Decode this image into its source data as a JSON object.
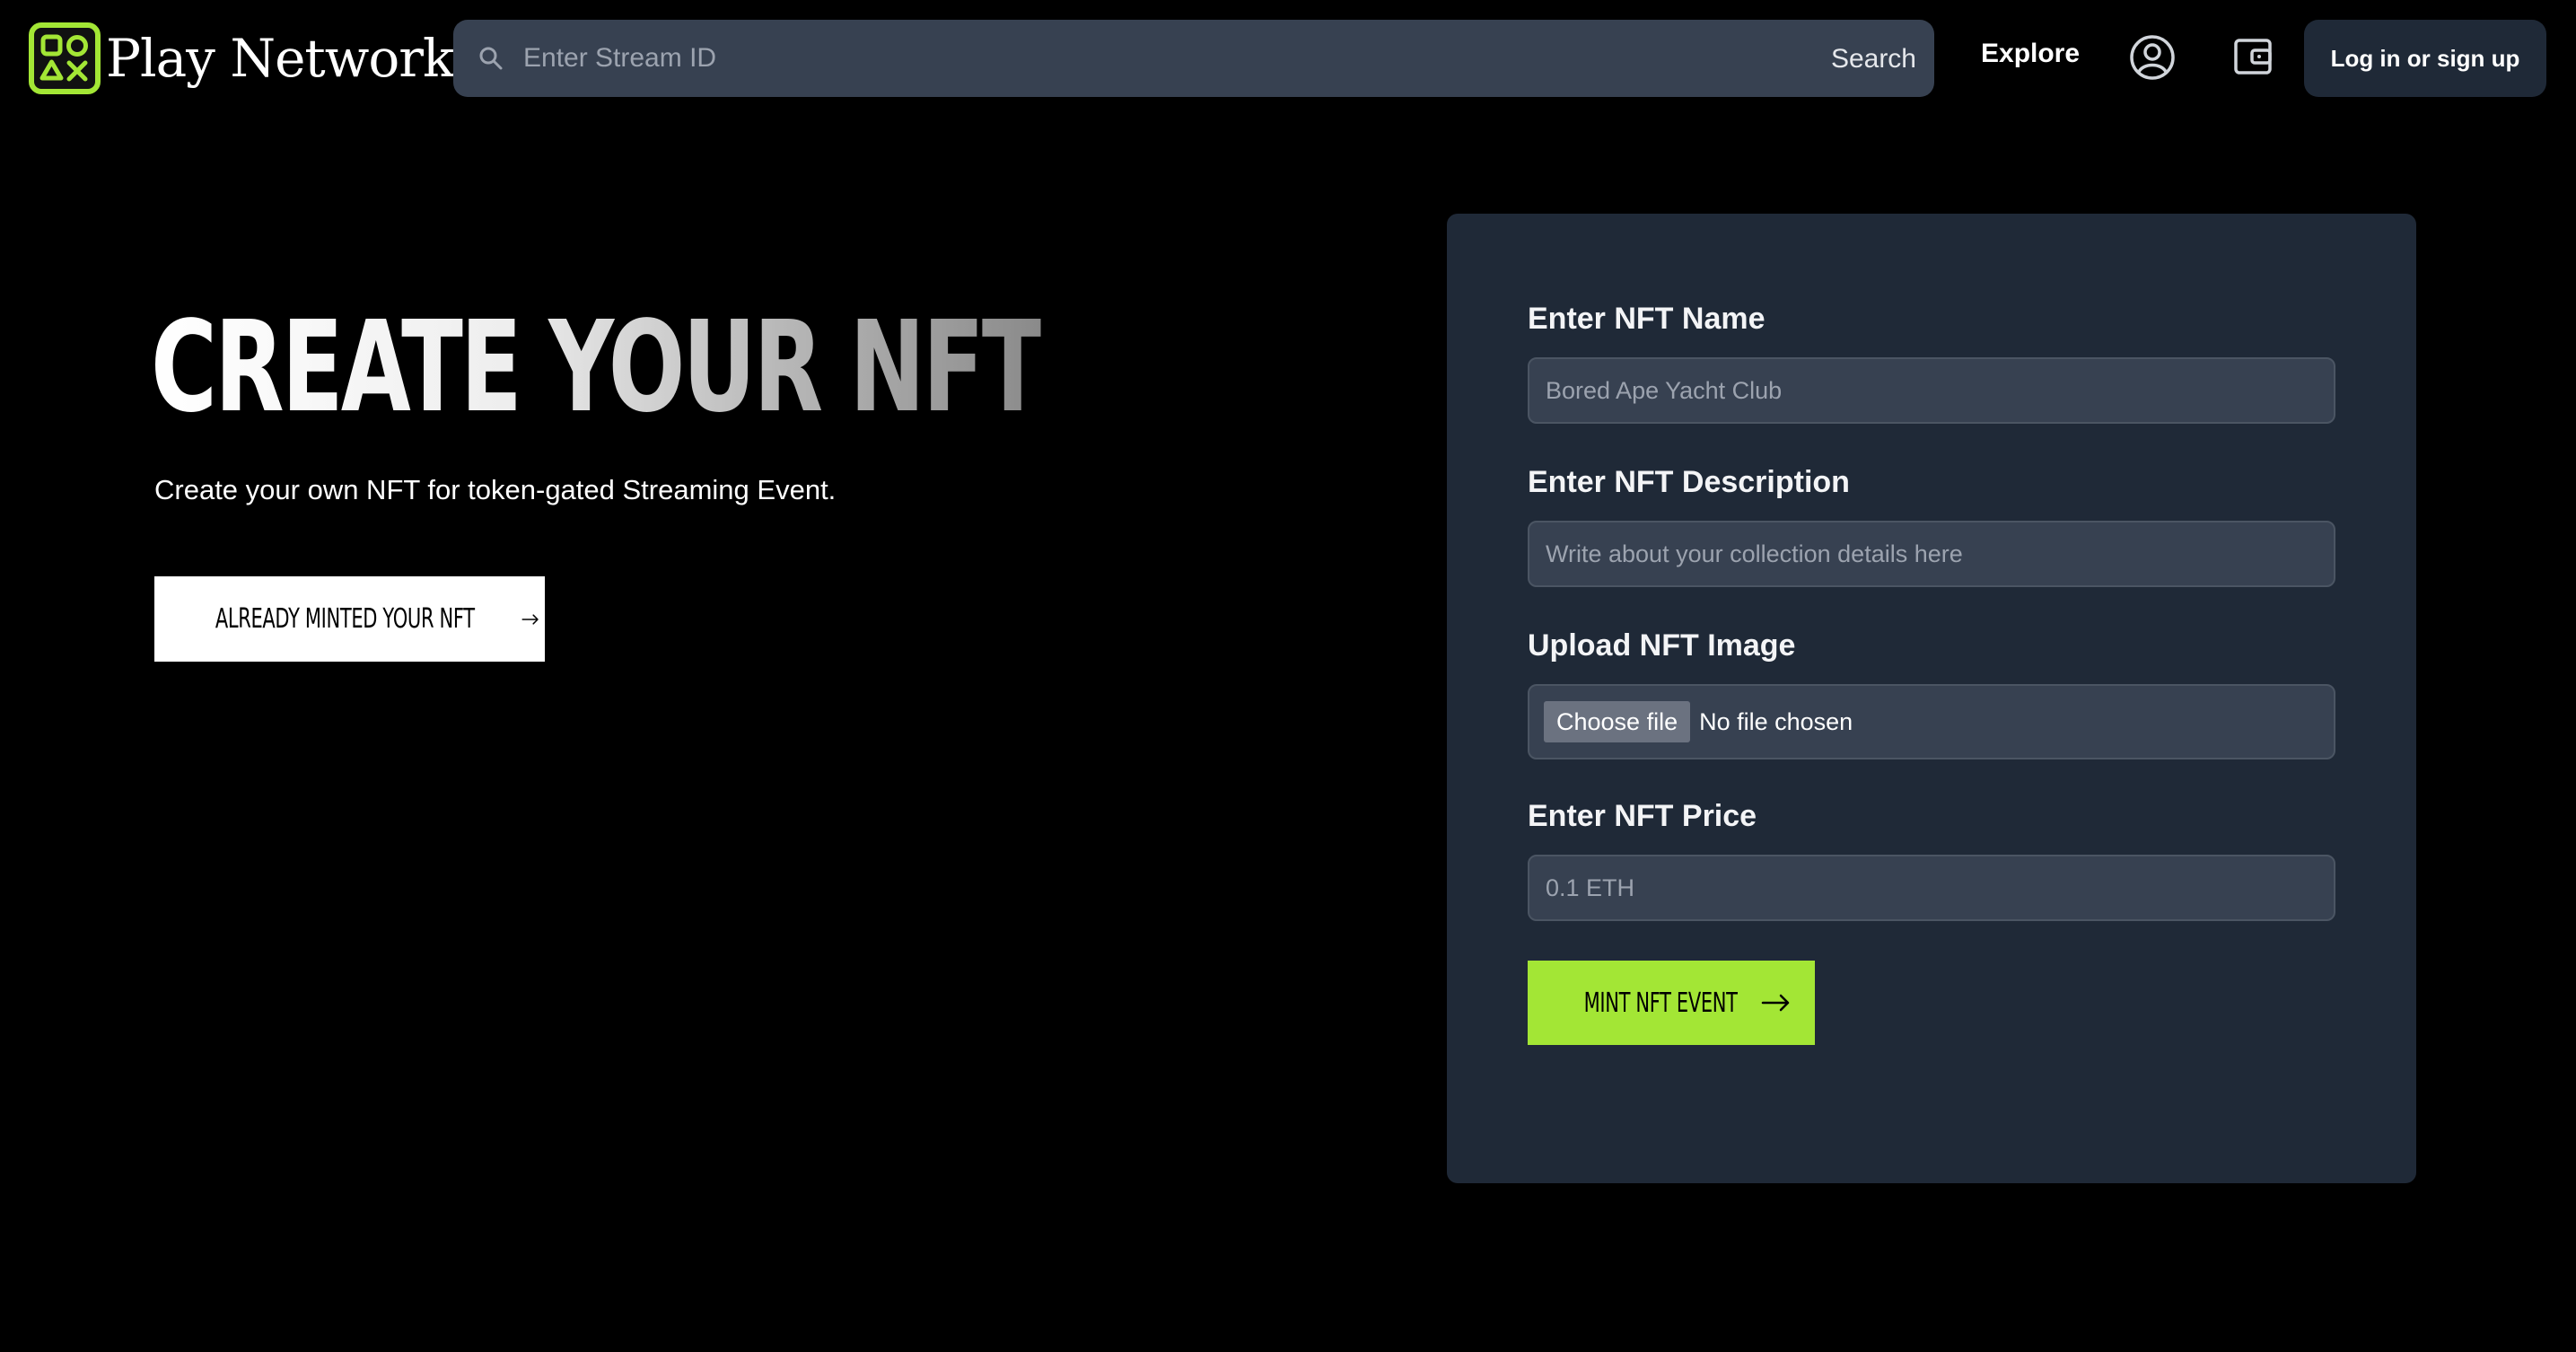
{
  "header": {
    "app_name": "Play Network",
    "search_placeholder": "Enter Stream ID",
    "search_button": "Search",
    "explore_link": "Explore",
    "login_button": "Log in or sign up",
    "icons": {
      "logo": "gamepad-buttons-logo-icon",
      "search": "search-icon",
      "profile": "user-circle-icon",
      "wallet": "wallet-icon"
    }
  },
  "hero": {
    "title": "CREATE YOUR NFT",
    "subtitle": "Create your own NFT for token-gated Streaming Event.",
    "minted_button": "ALREADY MINTED YOUR NFT"
  },
  "form": {
    "name_label": "Enter NFT Name",
    "name_placeholder": "Bored Ape Yacht Club",
    "description_label": "Enter NFT Description",
    "description_placeholder": "Write about your collection details here",
    "image_label": "Upload NFT Image",
    "file_button": "Choose file",
    "file_status": "No file chosen",
    "price_label": "Enter NFT Price",
    "price_placeholder": "0.1 ETH",
    "mint_button": "MINT NFT EVENT"
  },
  "colors": {
    "accent": "#a3e635",
    "background": "#000000",
    "card": "#1f2937",
    "input": "#374151"
  }
}
